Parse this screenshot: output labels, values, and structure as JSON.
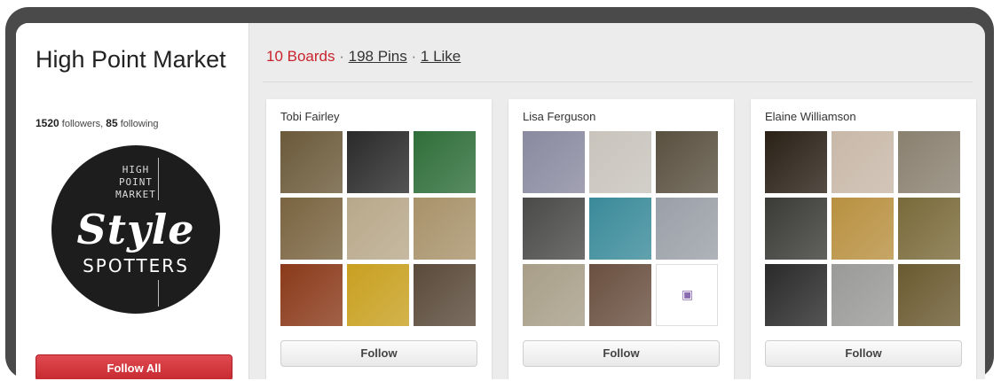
{
  "profile": {
    "name": "High Point Market",
    "followers": "1520",
    "followers_label": "followers,",
    "following": "85",
    "following_label": "following",
    "logo": {
      "line1": "HIGH",
      "line2": "POINT",
      "line3": "MARKET",
      "style": "Style",
      "spotters": "SPOTTERS"
    },
    "follow_all_label": "Follow All"
  },
  "header": {
    "boards": "10 Boards",
    "sep1": " · ",
    "pins": "198 Pins",
    "sep2": " · ",
    "likes": "1 Like"
  },
  "boards": [
    {
      "title": "Tobi Fairley",
      "follow_label": "Follow",
      "tiles": [
        "#6b5a3a",
        "#2a2a2a",
        "#2f6e3a",
        "#7a6440",
        "#b8a88a",
        "#a8926a",
        "#8a3a1a",
        "#c8a020",
        "#5a4a3a"
      ]
    },
    {
      "title": "Lisa Ferguson",
      "follow_label": "Follow",
      "tiles": [
        "#8a8aa0",
        "#c8c4bc",
        "#5a5040",
        "#4a4a48",
        "#3a8a9a",
        "#9aa0a8",
        "#a89e88",
        "#6a5040",
        "#ffffff"
      ]
    },
    {
      "title": "Elaine Williamson",
      "follow_label": "Follow",
      "tiles": [
        "#2a2016",
        "#c8b8a8",
        "#8a8070",
        "#3a3a36",
        "#b89040",
        "#7a6a3a",
        "#2a2a2a",
        "#9a9a98",
        "#6a5a30"
      ]
    }
  ],
  "colors": {
    "accent_red": "#c8232c",
    "frame": "#4a4a4a",
    "background": "#ececec"
  }
}
